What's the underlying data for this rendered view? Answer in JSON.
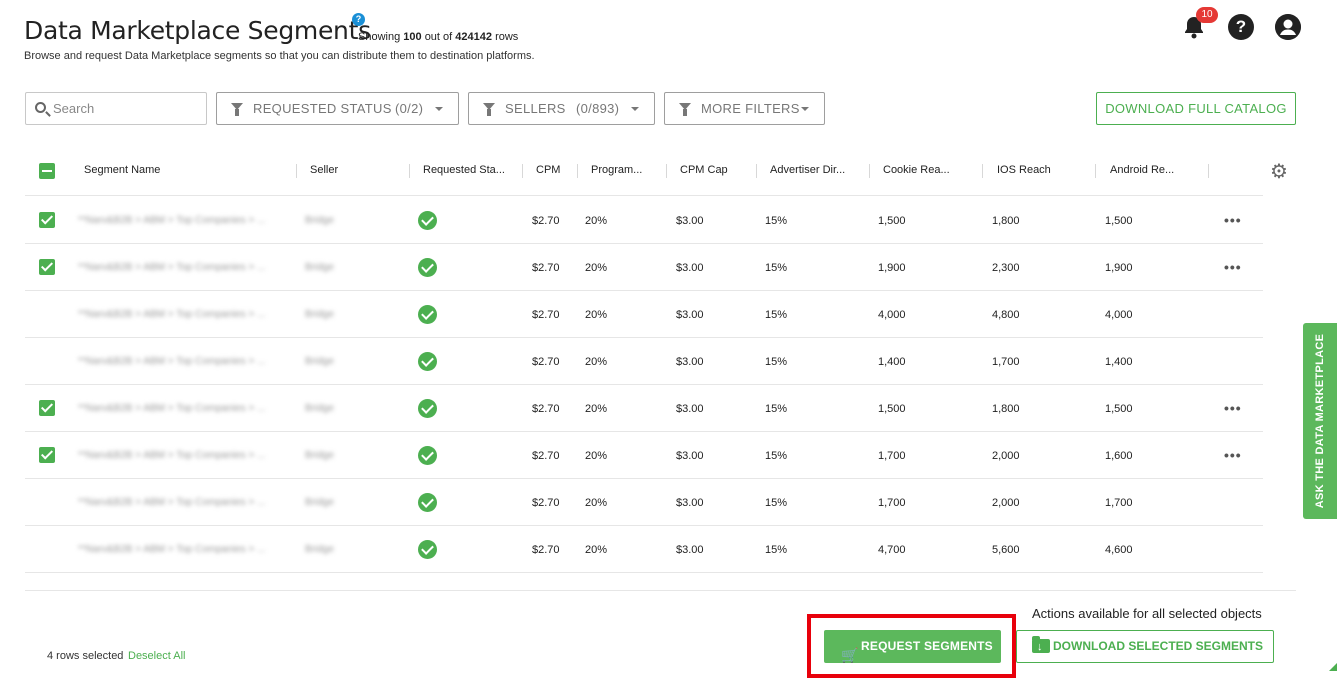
{
  "header": {
    "title": "Data Marketplace Segments",
    "help_glyph": "?",
    "showing_prefix": "Showing",
    "showing_count": "100",
    "showing_mid": "out of",
    "showing_total": "424142",
    "showing_suffix": "rows",
    "subtitle": "Browse and request Data Marketplace segments so that you can distribute them to destination platforms.",
    "notifications_count": "10",
    "help_icon_glyph": "?"
  },
  "toolbar": {
    "search_placeholder": "Search",
    "filter_requested_label": "REQUESTED STATUS",
    "filter_requested_count": "(0/2)",
    "filter_sellers_label": "SELLERS",
    "filter_sellers_count": "(0/893)",
    "filter_more_label": "MORE FILTERS",
    "download_catalog_label": "DOWNLOAD FULL CATALOG"
  },
  "table": {
    "columns": {
      "segment_name": "Segment Name",
      "seller": "Seller",
      "requested_status": "Requested Sta...",
      "cpm": "CPM",
      "programmatic": "Program...",
      "cpm_cap": "CPM Cap",
      "advertiser_direct": "Advertiser Dir...",
      "cookie_reach": "Cookie Rea...",
      "ios_reach": "IOS Reach",
      "android_reach": "Android Re..."
    },
    "blurred_segment_name": "**Narv&B2B > ABM > Top Companies > ...",
    "blurred_seller": "Bridge",
    "rows": [
      {
        "selected": true,
        "cpm": "$2.70",
        "programmatic": "20%",
        "cpm_cap": "$3.00",
        "advertiser_direct": "15%",
        "cookie_reach": "1,500",
        "ios_reach": "1,800",
        "android_reach": "1,500",
        "more": "•••"
      },
      {
        "selected": true,
        "cpm": "$2.70",
        "programmatic": "20%",
        "cpm_cap": "$3.00",
        "advertiser_direct": "15%",
        "cookie_reach": "1,900",
        "ios_reach": "2,300",
        "android_reach": "1,900",
        "more": "•••"
      },
      {
        "selected": false,
        "cpm": "$2.70",
        "programmatic": "20%",
        "cpm_cap": "$3.00",
        "advertiser_direct": "15%",
        "cookie_reach": "4,000",
        "ios_reach": "4,800",
        "android_reach": "4,000",
        "more": ""
      },
      {
        "selected": false,
        "cpm": "$2.70",
        "programmatic": "20%",
        "cpm_cap": "$3.00",
        "advertiser_direct": "15%",
        "cookie_reach": "1,400",
        "ios_reach": "1,700",
        "android_reach": "1,400",
        "more": ""
      },
      {
        "selected": true,
        "cpm": "$2.70",
        "programmatic": "20%",
        "cpm_cap": "$3.00",
        "advertiser_direct": "15%",
        "cookie_reach": "1,500",
        "ios_reach": "1,800",
        "android_reach": "1,500",
        "more": "•••"
      },
      {
        "selected": true,
        "cpm": "$2.70",
        "programmatic": "20%",
        "cpm_cap": "$3.00",
        "advertiser_direct": "15%",
        "cookie_reach": "1,700",
        "ios_reach": "2,000",
        "android_reach": "1,600",
        "more": "•••"
      },
      {
        "selected": false,
        "cpm": "$2.70",
        "programmatic": "20%",
        "cpm_cap": "$3.00",
        "advertiser_direct": "15%",
        "cookie_reach": "1,700",
        "ios_reach": "2,000",
        "android_reach": "1,700",
        "more": ""
      },
      {
        "selected": false,
        "cpm": "$2.70",
        "programmatic": "20%",
        "cpm_cap": "$3.00",
        "advertiser_direct": "15%",
        "cookie_reach": "4,700",
        "ios_reach": "5,600",
        "android_reach": "4,600",
        "more": ""
      }
    ]
  },
  "footer": {
    "rows_selected": "4 rows selected",
    "deselect_all": "Deselect All",
    "actions_label": "Actions available for all selected objects",
    "request_segments": "REQUEST SEGMENTS",
    "download_selected": "DOWNLOAD SELECTED SEGMENTS"
  },
  "side_tab": {
    "label": "ASK THE DATA MARKETPLACE"
  },
  "colors": {
    "accent_green": "#4caf50",
    "button_green": "#5cb85c",
    "badge_red": "#e53935",
    "highlight_red": "#e8000b",
    "help_blue": "#1a8fd6"
  },
  "icons": {
    "cart": "🛒",
    "gear": "⚙"
  }
}
